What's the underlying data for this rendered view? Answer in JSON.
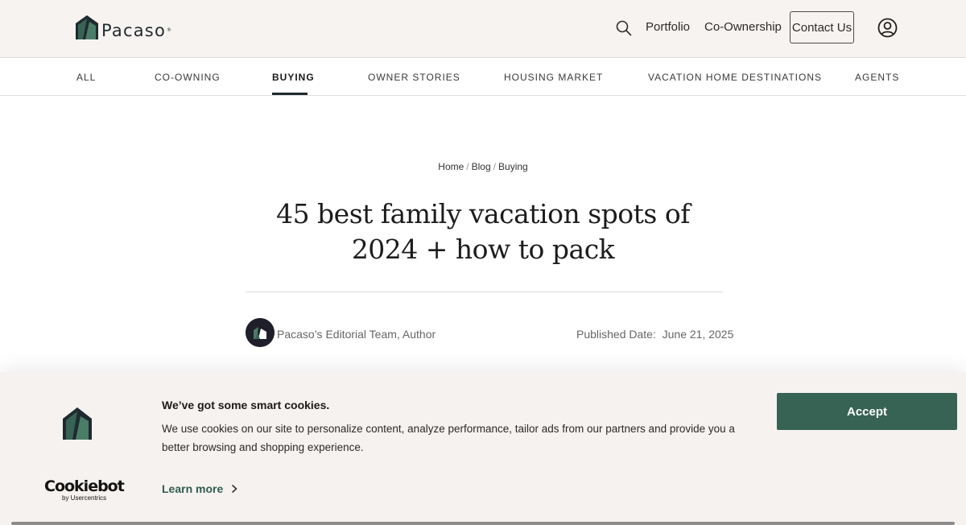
{
  "header": {
    "logo_text": "Pacaso",
    "nav": {
      "portfolio": "Portfolio",
      "coownership": "Co-Ownership"
    },
    "contact_label": "Contact Us"
  },
  "categories": [
    "ALL",
    "CO-OWNING",
    "BUYING",
    "OWNER STORIES",
    "HOUSING MARKET",
    "VACATION HOME DESTINATIONS",
    "AGENTS"
  ],
  "active_category": "BUYING",
  "breadcrumb": {
    "home": "Home",
    "blog": "Blog",
    "current": "Buying",
    "separator": "/"
  },
  "article": {
    "title": "45 best family vacation spots of 2024 + how to pack",
    "author": "Pacaso’s Editorial Team, Author",
    "published_label": "Published Date:",
    "published_date": "June 21, 2025"
  },
  "cookie_banner": {
    "heading": "We’ve got some smart cookies.",
    "text": "We use cookies on our site to personalize content, analyze performance, tailor ads from our partners and provide you a better browsing and shopping experience.",
    "learn_more": "Learn more",
    "accept": "Accept",
    "brand_name": "Cookiebot",
    "brand_sub": "by Usercentrics"
  },
  "colors": {
    "header_bg": "#f7f3f0",
    "brand_green": "#376354",
    "logo_dark": "#1f2a30",
    "cookie_bg": "#f6f2ef"
  },
  "icons": [
    "pacaso-logo-icon",
    "search-icon",
    "account-icon",
    "author-avatar-icon",
    "chevron-right-icon"
  ]
}
